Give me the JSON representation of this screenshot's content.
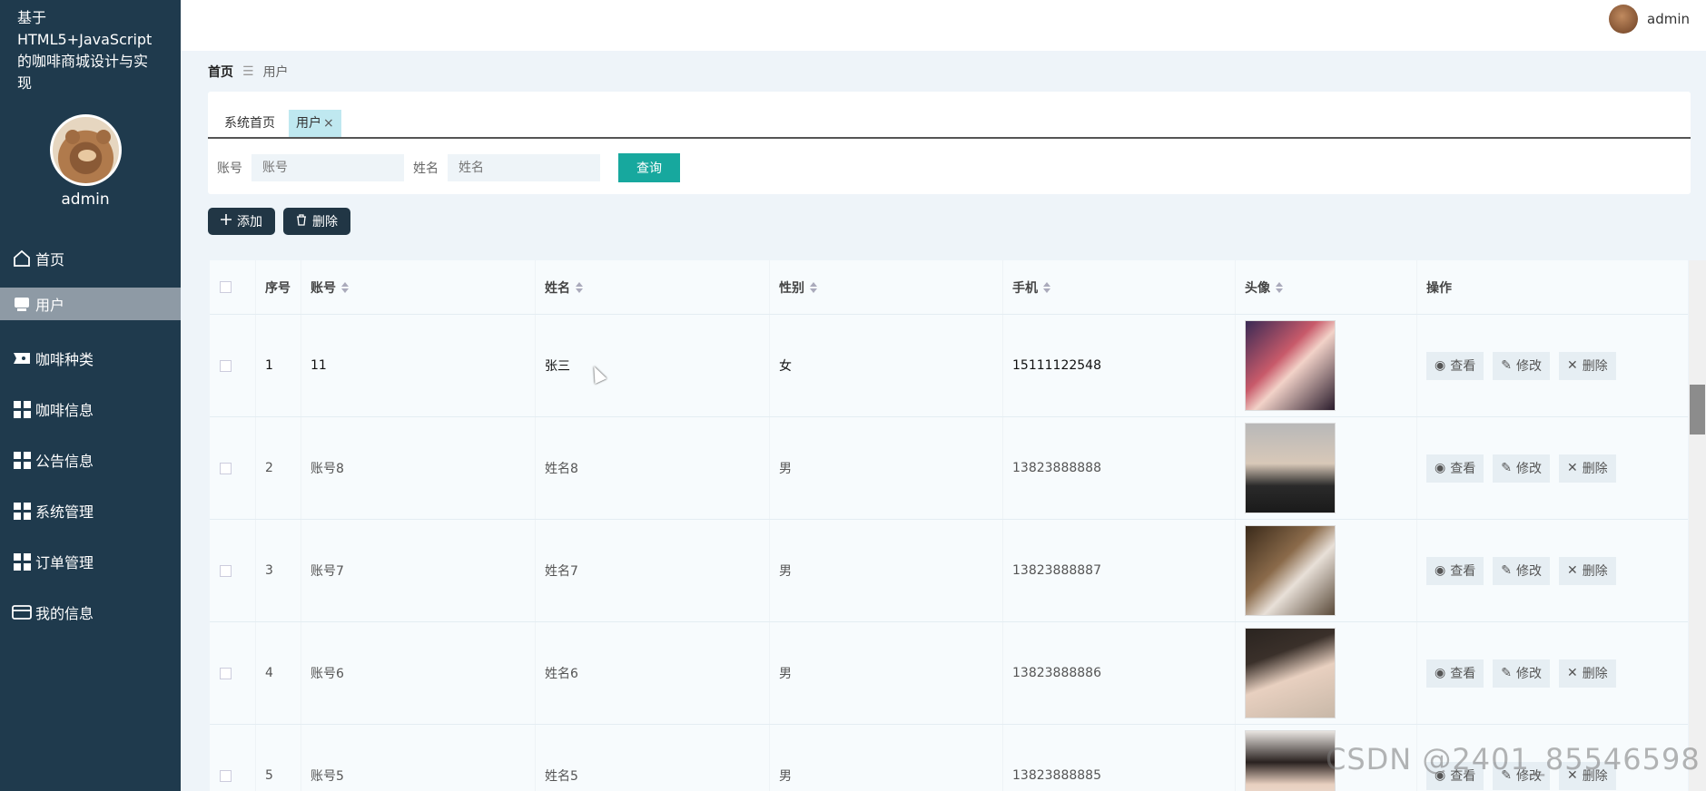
{
  "app_title": "基于HTML5+JavaScript的咖啡商城设计与实现",
  "user": {
    "name": "admin"
  },
  "sidebar": {
    "items": [
      {
        "label": "首页",
        "icon": "home-icon"
      },
      {
        "label": "用户",
        "icon": "user-icon"
      },
      {
        "label": "咖啡种类",
        "icon": "tag-icon"
      },
      {
        "label": "咖啡信息",
        "icon": "grid-icon"
      },
      {
        "label": "公告信息",
        "icon": "grid-icon"
      },
      {
        "label": "系统管理",
        "icon": "grid-icon"
      },
      {
        "label": "订单管理",
        "icon": "grid-icon"
      },
      {
        "label": "我的信息",
        "icon": "card-icon"
      }
    ],
    "active_index": 1
  },
  "breadcrumb": {
    "home": "首页",
    "separator": "☰",
    "current": "用户"
  },
  "tabs": [
    {
      "label": "系统首页"
    },
    {
      "label": "用户",
      "close": "×"
    }
  ],
  "search": {
    "account_label": "账号",
    "account_placeholder": "账号",
    "name_label": "姓名",
    "name_placeholder": "姓名",
    "query_label": "查询"
  },
  "toolbar": {
    "add_label": "添加",
    "delete_label": "删除"
  },
  "table": {
    "headers": [
      "序号",
      "账号",
      "姓名",
      "性别",
      "手机",
      "头像",
      "操作"
    ],
    "rows": [
      {
        "index": "1",
        "account": "11",
        "name": "张三",
        "gender": "女",
        "phone": "15111122548"
      },
      {
        "index": "2",
        "account": "账号8",
        "name": "姓名8",
        "gender": "男",
        "phone": "13823888888"
      },
      {
        "index": "3",
        "account": "账号7",
        "name": "姓名7",
        "gender": "男",
        "phone": "13823888887"
      },
      {
        "index": "4",
        "account": "账号6",
        "name": "姓名6",
        "gender": "男",
        "phone": "13823888886"
      },
      {
        "index": "5",
        "account": "账号5",
        "name": "姓名5",
        "gender": "男",
        "phone": "13823888885"
      }
    ],
    "ops": {
      "view": "查看",
      "edit": "修改",
      "delete": "删除"
    }
  },
  "watermark": "CSDN @2401_85546598",
  "colors": {
    "sidebar": "#1f3a4d",
    "accent": "#17a89e",
    "tab_active": "#bfe8f0",
    "button_dark": "#213645"
  }
}
